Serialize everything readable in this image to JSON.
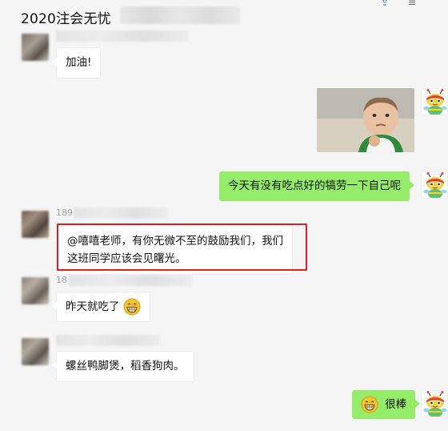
{
  "header": {
    "title": "2020注会无忧"
  },
  "toolbar": {
    "icons": [
      "share-icon",
      "menu-icon"
    ]
  },
  "messages": [
    {
      "side": "left",
      "sender": "",
      "text": "加油!"
    },
    {
      "side": "right",
      "type": "image",
      "image_icon": "baby-photo"
    },
    {
      "side": "right",
      "text": "今天有没有吃点好的犒劳一下自己呢"
    },
    {
      "side": "left",
      "sender": "189        g    ",
      "line1": "@嘻嘻老师，有你无微不至的鼓励我们，我们",
      "line2": "这班同学应该会见曙光。"
    },
    {
      "side": "left",
      "sender": "18",
      "text": "昨天就吃了",
      "emoji": "grin-emoji"
    },
    {
      "side": "left",
      "sender": "",
      "text": "螺丝鸭脚煲，稻香狗肉。"
    },
    {
      "side": "right",
      "text": "很棒",
      "emoji": "grin-emoji"
    }
  ],
  "colors": {
    "background": "#f5f5f5",
    "bubble_right": "#95ec69",
    "bubble_left": "#ffffff",
    "highlight": "#e02020"
  }
}
